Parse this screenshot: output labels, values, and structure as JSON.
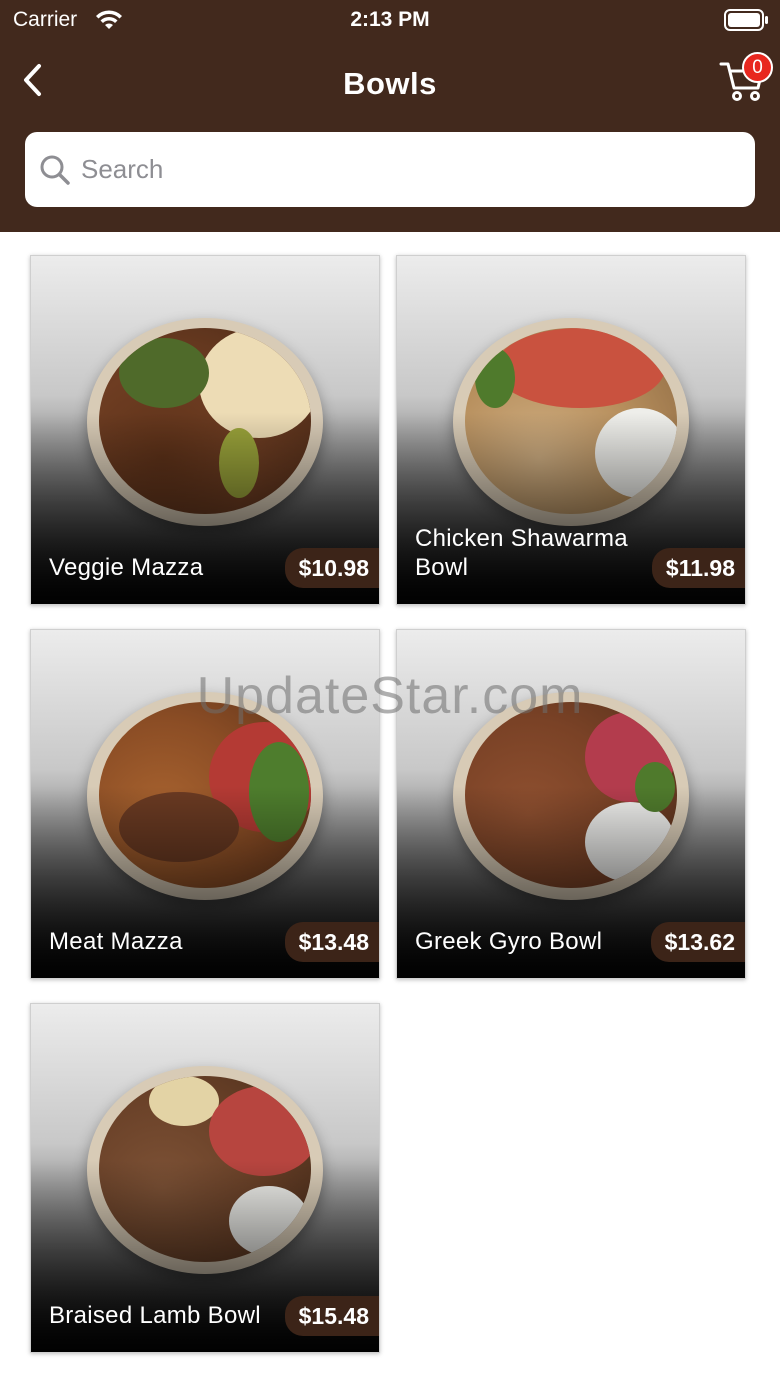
{
  "status_bar": {
    "carrier": "Carrier",
    "time": "2:13 PM"
  },
  "nav": {
    "title": "Bowls",
    "cart_count": "0"
  },
  "search": {
    "placeholder": "Search"
  },
  "products": [
    {
      "name": "Veggie Mazza",
      "price": "$10.98"
    },
    {
      "name": "Chicken Shawarma Bowl",
      "price": "$11.98"
    },
    {
      "name": "Meat Mazza",
      "price": "$13.48"
    },
    {
      "name": "Greek Gyro Bowl",
      "price": "$13.62"
    },
    {
      "name": "Braised Lamb Bowl",
      "price": "$15.48"
    }
  ],
  "watermark": "UpdateStar.com",
  "colors": {
    "header": "#42291d",
    "badge": "#e8271f",
    "price_tag": "#3c2418"
  }
}
